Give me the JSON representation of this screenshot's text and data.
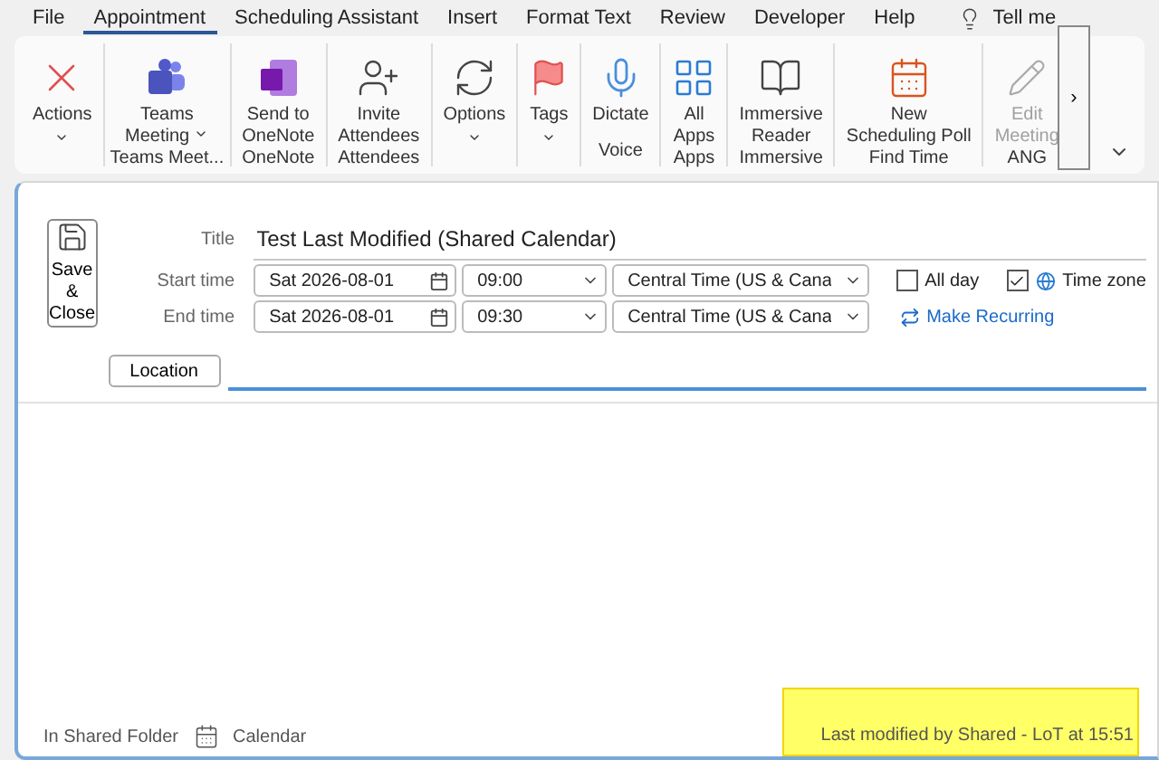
{
  "menu_tabs": [
    {
      "label": "File",
      "selected": false
    },
    {
      "label": "Appointment",
      "selected": true
    },
    {
      "label": "Scheduling Assistant",
      "selected": false
    },
    {
      "label": "Insert",
      "selected": false
    },
    {
      "label": "Format Text",
      "selected": false
    },
    {
      "label": "Review",
      "selected": false
    },
    {
      "label": "Developer",
      "selected": false
    },
    {
      "label": "Help",
      "selected": false
    }
  ],
  "tell_me": {
    "placeholder": "Tell me"
  },
  "ribbon_groups": [
    {
      "buttons": [
        {
          "label": "Actions",
          "kind": "menu",
          "disabled": false
        }
      ]
    },
    {
      "label": "Teams Meet...",
      "buttons": [
        {
          "label": "Teams\nMeeting",
          "kind": "split",
          "disabled": false
        }
      ]
    },
    {
      "label": "OneNote",
      "buttons": [
        {
          "label": "Send to\nOneNote",
          "kind": "plain",
          "disabled": false
        }
      ]
    },
    {
      "label": "Attendees",
      "buttons": [
        {
          "label": "Invite\nAttendees",
          "kind": "plain",
          "disabled": false
        }
      ]
    },
    {
      "buttons": [
        {
          "label": "Options",
          "kind": "menu",
          "disabled": false
        }
      ]
    },
    {
      "buttons": [
        {
          "label": "Tags",
          "kind": "menu",
          "disabled": false
        }
      ]
    },
    {
      "label": "Voice",
      "buttons": [
        {
          "label": "Dictate",
          "kind": "plain",
          "disabled": false
        }
      ]
    },
    {
      "label": "Apps",
      "buttons": [
        {
          "label": "All\nApps",
          "kind": "plain",
          "disabled": false
        }
      ]
    },
    {
      "label": "Immersive",
      "buttons": [
        {
          "label": "Immersive\nReader",
          "kind": "plain",
          "disabled": false
        }
      ]
    },
    {
      "label": "Find Time",
      "buttons": [
        {
          "label": "New\nScheduling Poll",
          "kind": "plain",
          "disabled": false
        }
      ]
    },
    {
      "label": "ANG",
      "buttons": [
        {
          "label": "Edit\nMeeting",
          "kind": "plain",
          "disabled": true
        }
      ]
    }
  ],
  "overflow_button": {
    "label": "›"
  },
  "save_close": {
    "label": "Save &\nClose"
  },
  "title_field": {
    "label": "Title",
    "value": "Test Last Modified (Shared Calendar)"
  },
  "time_rows": [
    {
      "label": "Start time",
      "date": "Sat 2026-08-01",
      "time": "09:00",
      "zone": "Central Time (US & Cana"
    },
    {
      "label": "End time",
      "date": "Sat 2026-08-01",
      "time": "09:30",
      "zone": "Central Time (US & Cana"
    }
  ],
  "all_day": {
    "label": "All day",
    "checked": false
  },
  "time_zone": {
    "label": "Time zone",
    "checked": true
  },
  "make_recurring": {
    "label": "Make Recurring"
  },
  "location": {
    "button": "Location"
  },
  "status_bar": {
    "folder_label": "In Shared Folder",
    "folder": "Calendar",
    "modified": "Last modified by Shared - LoT at 15:51",
    "highlighted": true
  }
}
